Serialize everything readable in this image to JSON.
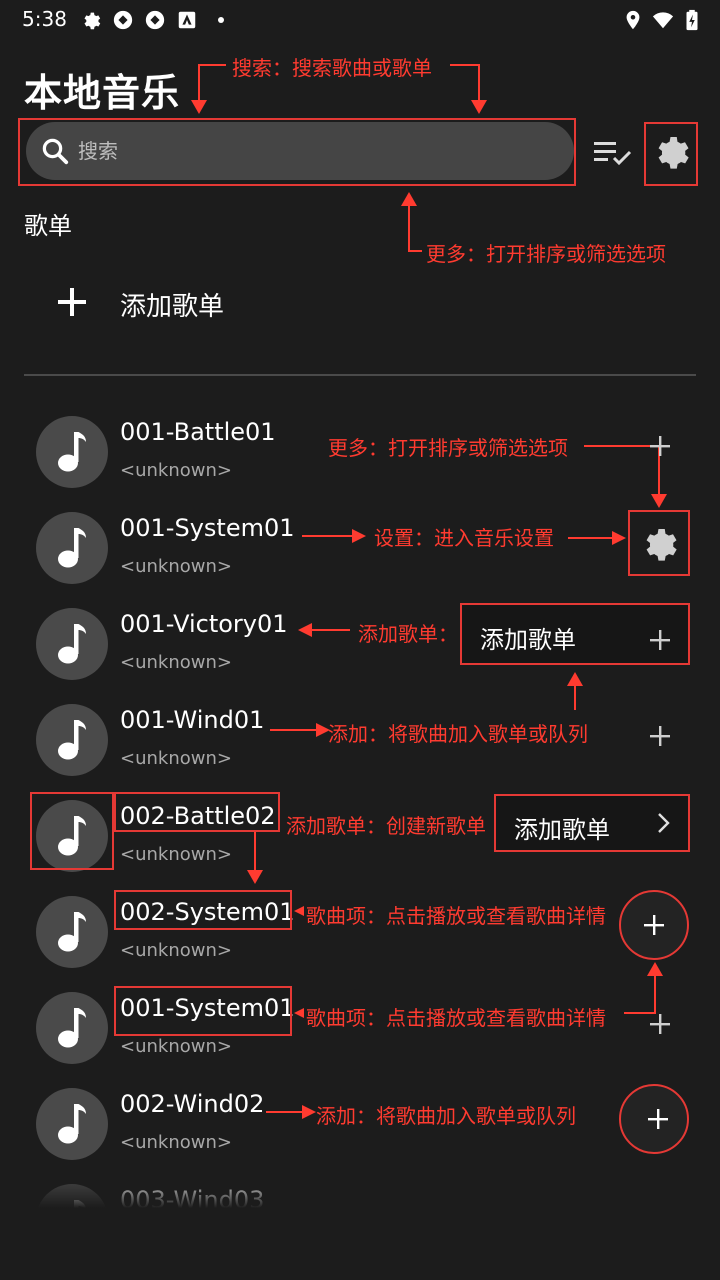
{
  "status_bar": {
    "time": "5:38",
    "left_icons": [
      "gear-icon",
      "app-icon",
      "app-icon",
      "app-store-icon",
      "dot-icon"
    ],
    "right_icons": [
      "location-icon",
      "wifi-icon",
      "battery-charging-icon"
    ]
  },
  "header": {
    "title": "本地音乐",
    "search_placeholder": "搜索"
  },
  "playlists": {
    "section_title": "歌单",
    "add_label": "添加歌单"
  },
  "songs": [
    {
      "title": "001-Battle01",
      "artist": "<unknown>"
    },
    {
      "title": "001-System01",
      "artist": "<unknown>"
    },
    {
      "title": "001-Victory01",
      "artist": "<unknown>"
    },
    {
      "title": "001-Wind01",
      "artist": "<unknown>"
    },
    {
      "title": "002-Battle02",
      "artist": "<unknown>"
    },
    {
      "title": "002-System01",
      "artist": "<unknown>"
    },
    {
      "title": "001-System01",
      "artist": "<unknown>"
    },
    {
      "title": "002-Wind02",
      "artist": "<unknown>"
    },
    {
      "title": "003-Wind03",
      "artist": ""
    }
  ],
  "annotations": {
    "search": "搜索：搜索歌曲或歌单",
    "more_top": "更多：打开排序或筛选选项",
    "more_row": "更多：打开排序或筛选选项",
    "settings": "设置：进入音乐设置",
    "add_playlist_short": "添加歌单：",
    "add_to_queue_1": "添加：将歌曲加入歌单或队列",
    "add_playlist_create": "添加歌单：创建新歌单",
    "song_item_1": "歌曲项：点击播放或查看歌曲详情",
    "song_item_2": "歌曲项：点击播放或查看歌曲详情",
    "add_to_queue_2": "添加：将歌曲加入歌单或队列"
  },
  "callouts": {
    "add_playlist_btn": "添加歌单",
    "add_playlist_nav_btn": "添加歌单"
  },
  "colors": {
    "background": "#1c1c1c",
    "search_field": "#454545",
    "avatar": "#4a4a4a",
    "annotation_red": "#e53935"
  }
}
